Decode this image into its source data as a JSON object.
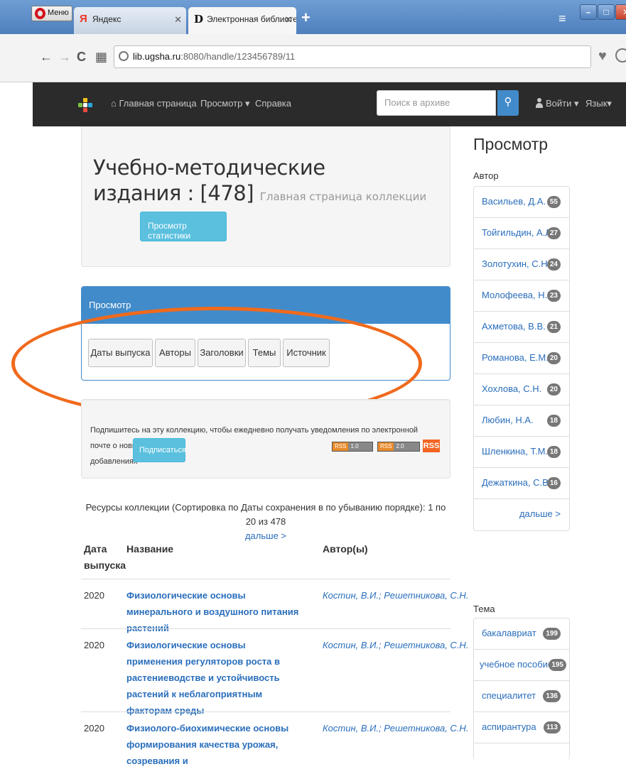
{
  "browser": {
    "menu_label": "Меню",
    "tabs": [
      {
        "label": "Яндекс",
        "favicon": "Я"
      },
      {
        "label": "Электронная библиотека У",
        "favicon": "D"
      }
    ],
    "url_domain": "lib.ugsha.ru",
    "url_rest": ":8080/handle/123456789/11"
  },
  "navbar": {
    "home": "Главная страница",
    "browse": "Просмотр",
    "help": "Справка",
    "search_placeholder": "Поиск в архиве",
    "login": "Войти",
    "language": "Язык"
  },
  "hero": {
    "title_line1": "Учебно-методические",
    "title_line2": "издания : [478]",
    "subtitle": "Главная страница коллекции",
    "stats_button": "Просмотр статистики"
  },
  "browse_panel": {
    "heading": "Просмотр",
    "buttons": [
      "Даты выпуска",
      "Авторы",
      "Заголовки",
      "Темы",
      "Источник"
    ]
  },
  "subscribe": {
    "text_line1": "Подпишитесь на эту коллекцию, чтобы ежедневно получать уведомления по электронной почте о новых",
    "text_line2": "добавлениях",
    "button": "Подписаться",
    "rss1": [
      "RSS",
      "1.0"
    ],
    "rss2": [
      "RSS",
      "2.0"
    ],
    "rss3": "RSS"
  },
  "resources": {
    "caption": "Ресурсы коллекции (Сортировка по Даты сохранения в по убыванию порядке): 1 по 20 из 478",
    "next": "дальше >",
    "headers": {
      "date_line1": "Дата",
      "date_line2": "выпуска",
      "title": "Название",
      "author": "Автор(ы)"
    },
    "rows": [
      {
        "year": "2020",
        "title": "Физиологические основы минерального и воздушного питания растений",
        "authors": [
          "Костин, В.И.",
          "Решетникова, С.Н."
        ]
      },
      {
        "year": "2020",
        "title": "Физиологические основы применения регуляторов роста в растениеводстве и устойчивость растений к неблагоприятным факторам среды",
        "authors": [
          "Костин, В.И.",
          "Решетникова, С.Н."
        ]
      },
      {
        "year": "2020",
        "title": "Физиолого-биохимические основы формирования качества урожая, созревания и",
        "authors": [
          "Костин, В.И.",
          "Решетникова, С.Н."
        ]
      }
    ]
  },
  "sidebar": {
    "title": "Просмотр",
    "author_label": "Автор",
    "authors": [
      {
        "name": "Васильев, Д.А.",
        "count": "55"
      },
      {
        "name": "Тойгильдин, А.Л.",
        "count": "27"
      },
      {
        "name": "Золотухин, С.Н.",
        "count": "24"
      },
      {
        "name": "Молофеева, Н.И.",
        "count": "23"
      },
      {
        "name": "Ахметова, В.В.",
        "count": "21"
      },
      {
        "name": "Романова, Е.М.",
        "count": "20"
      },
      {
        "name": "Хохлова, С.Н.",
        "count": "20"
      },
      {
        "name": "Любин, Н.А.",
        "count": "18"
      },
      {
        "name": "Шленкина, Т.М.",
        "count": "18"
      },
      {
        "name": "Дежаткина, С.В.",
        "count": "16"
      }
    ],
    "authors_more": "дальше >",
    "subject_label": "Тема",
    "subjects": [
      {
        "name": "бакалавриат",
        "count": "199"
      },
      {
        "name": "учебное пособие",
        "count": "195"
      },
      {
        "name": "специалитет",
        "count": "136"
      },
      {
        "name": "аспирантура",
        "count": "113"
      }
    ]
  },
  "colors": {
    "navbar": "#2b2b2b",
    "primary": "#428bca",
    "info_button": "#5bc0de",
    "highlight_annotation": "#f06a1c",
    "link": "#2a6ebb"
  }
}
